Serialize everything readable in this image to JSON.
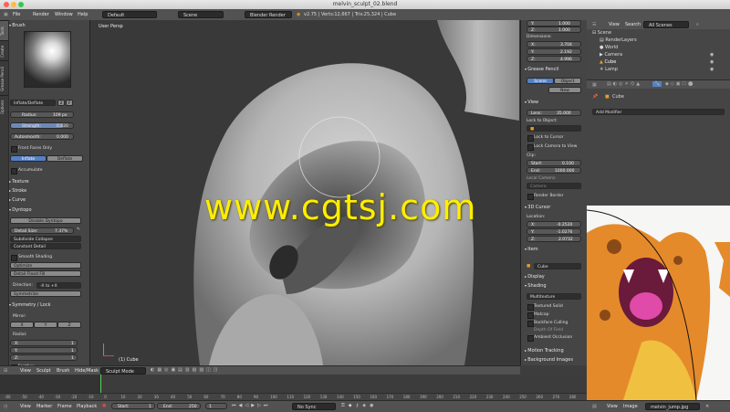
{
  "window": {
    "title": "melvin_sculpt_02.blend"
  },
  "header": {
    "menus": [
      "File",
      "Render",
      "Window",
      "Help"
    ],
    "layout": "Default",
    "scene": "Scene",
    "engine": "Blender Render",
    "stats": "v2.75 | Verts:12,667 | Tris:25,324 | Cube"
  },
  "toolshelf": {
    "tabs": [
      "Tools",
      "Create",
      "Grease Pencil",
      "Options"
    ],
    "brush_header": "Brush",
    "brush_name": "Inflate/Deflate",
    "brush_users": "2",
    "brush_f": "F",
    "radius": "Radius:",
    "radius_val": "109 px",
    "strength": "Strength:",
    "strength_val": "0.820",
    "autosmooth": "Autosmooth:",
    "autosmooth_val": "0.000",
    "front_faces": "Front Faces Only",
    "inflate": "Inflate",
    "deflate": "Deflate",
    "accumulate": "Accumulate",
    "texture": "Texture",
    "stroke": "Stroke",
    "curve": "Curve",
    "dyntopo": "Dyntopo",
    "disable_dyntopo": "Disable Dyntopo",
    "detail_size": "Detail Size:",
    "detail_size_val": "7.37%",
    "subdivide_collapse": "Subdivide Collapse",
    "constant_detail": "Constant Detail",
    "smooth_shading": "Smooth Shading",
    "optimize": "Optimize",
    "detail_flood": "Detail Flood Fill",
    "direction": "Direction:",
    "direction_val": "-X to +X",
    "symmetrize": "Symmetrize",
    "symmetry": "Symmetry / Lock",
    "mirror": "Mirror:",
    "x": "X",
    "y": "Y",
    "z": "Z",
    "radial": "Radial:",
    "rx": "X:",
    "ry": "Y:",
    "rz": "Z:",
    "r1": "1",
    "feather": "Feather",
    "lock": "Lock:"
  },
  "viewport": {
    "label": "User Persp",
    "object": "(1) Cube"
  },
  "watermark": "www.cgtsj.com",
  "props": {
    "top_y": "Y:",
    "top_y_val": "1.000",
    "top_z": "Z:",
    "top_z_val": "1.000",
    "dimensions": "Dimensions:",
    "dx": "X:",
    "dx_val": "3.704",
    "dy": "Y:",
    "dy_val": "2.192",
    "dz": "Z:",
    "dz_val": "4.996",
    "grease": "Grease Pencil",
    "gp_scene": "Scene",
    "gp_object": "Object",
    "gp_new": "New",
    "view": "View",
    "lens": "Lens:",
    "lens_val": "35.000",
    "lock_obj": "Lock to Object:",
    "lock_cursor": "Lock to Cursor",
    "lock_camera": "Lock Camera to View",
    "clip": "Clip:",
    "start": "Start:",
    "start_val": "0.100",
    "end": "End:",
    "end_val": "1000.000",
    "local_camera": "Local Camera:",
    "camera": "Camera",
    "render_border": "Render Border",
    "cursor3d": "3D Cursor",
    "location": "Location:",
    "cx": "X:",
    "cx_val": "-0.2520",
    "cy": "Y:",
    "cy_val": "-1.0276",
    "cz": "Z:",
    "cz_val": "2.0732",
    "item": "Item",
    "item_name": "Cube",
    "display": "Display",
    "shading": "Shading",
    "multitexture": "Multitexture",
    "textured_solid": "Textured Solid",
    "matcap": "Matcap",
    "backface": "Backface Culling",
    "depth_field": "Depth Of Field",
    "ambient": "Ambient Occlusion",
    "motion": "Motion Tracking",
    "bg_images": "Background Images"
  },
  "outliner": {
    "view": "View",
    "search": "Search",
    "scenes": "All Scenes",
    "items": [
      "Scene",
      "RenderLayers",
      "World",
      "Camera",
      "Cube",
      "Lamp"
    ]
  },
  "properties_editor": {
    "crumb": "Cube",
    "add_modifier": "Add Modifier"
  },
  "image_editor": {
    "menus": [
      "View",
      "Image"
    ],
    "file": "melvin_jump.jpg"
  },
  "vpfooter": {
    "menus": [
      "View",
      "Sculpt",
      "Brush",
      "Hide/Mask"
    ],
    "mode": "Sculpt Mode"
  },
  "timeline": {
    "ticks": [
      "-60",
      "-50",
      "-40",
      "-30",
      "-20",
      "-10",
      "0",
      "10",
      "20",
      "30",
      "40",
      "50",
      "60",
      "70",
      "80",
      "90",
      "100",
      "110",
      "120",
      "130",
      "140",
      "150",
      "160",
      "170",
      "180",
      "190",
      "200",
      "210",
      "220",
      "230",
      "240",
      "250",
      "260",
      "270",
      "280"
    ],
    "menus": [
      "View",
      "Marker",
      "Frame",
      "Playback"
    ],
    "start": "Start:",
    "start_val": "1",
    "end": "End:",
    "end_val": "250",
    "current": "1",
    "sync": "No Sync"
  },
  "colors": {
    "accent": "#5680c2",
    "watermark": "#ffee00",
    "outline_orange": "#e89b2c"
  }
}
